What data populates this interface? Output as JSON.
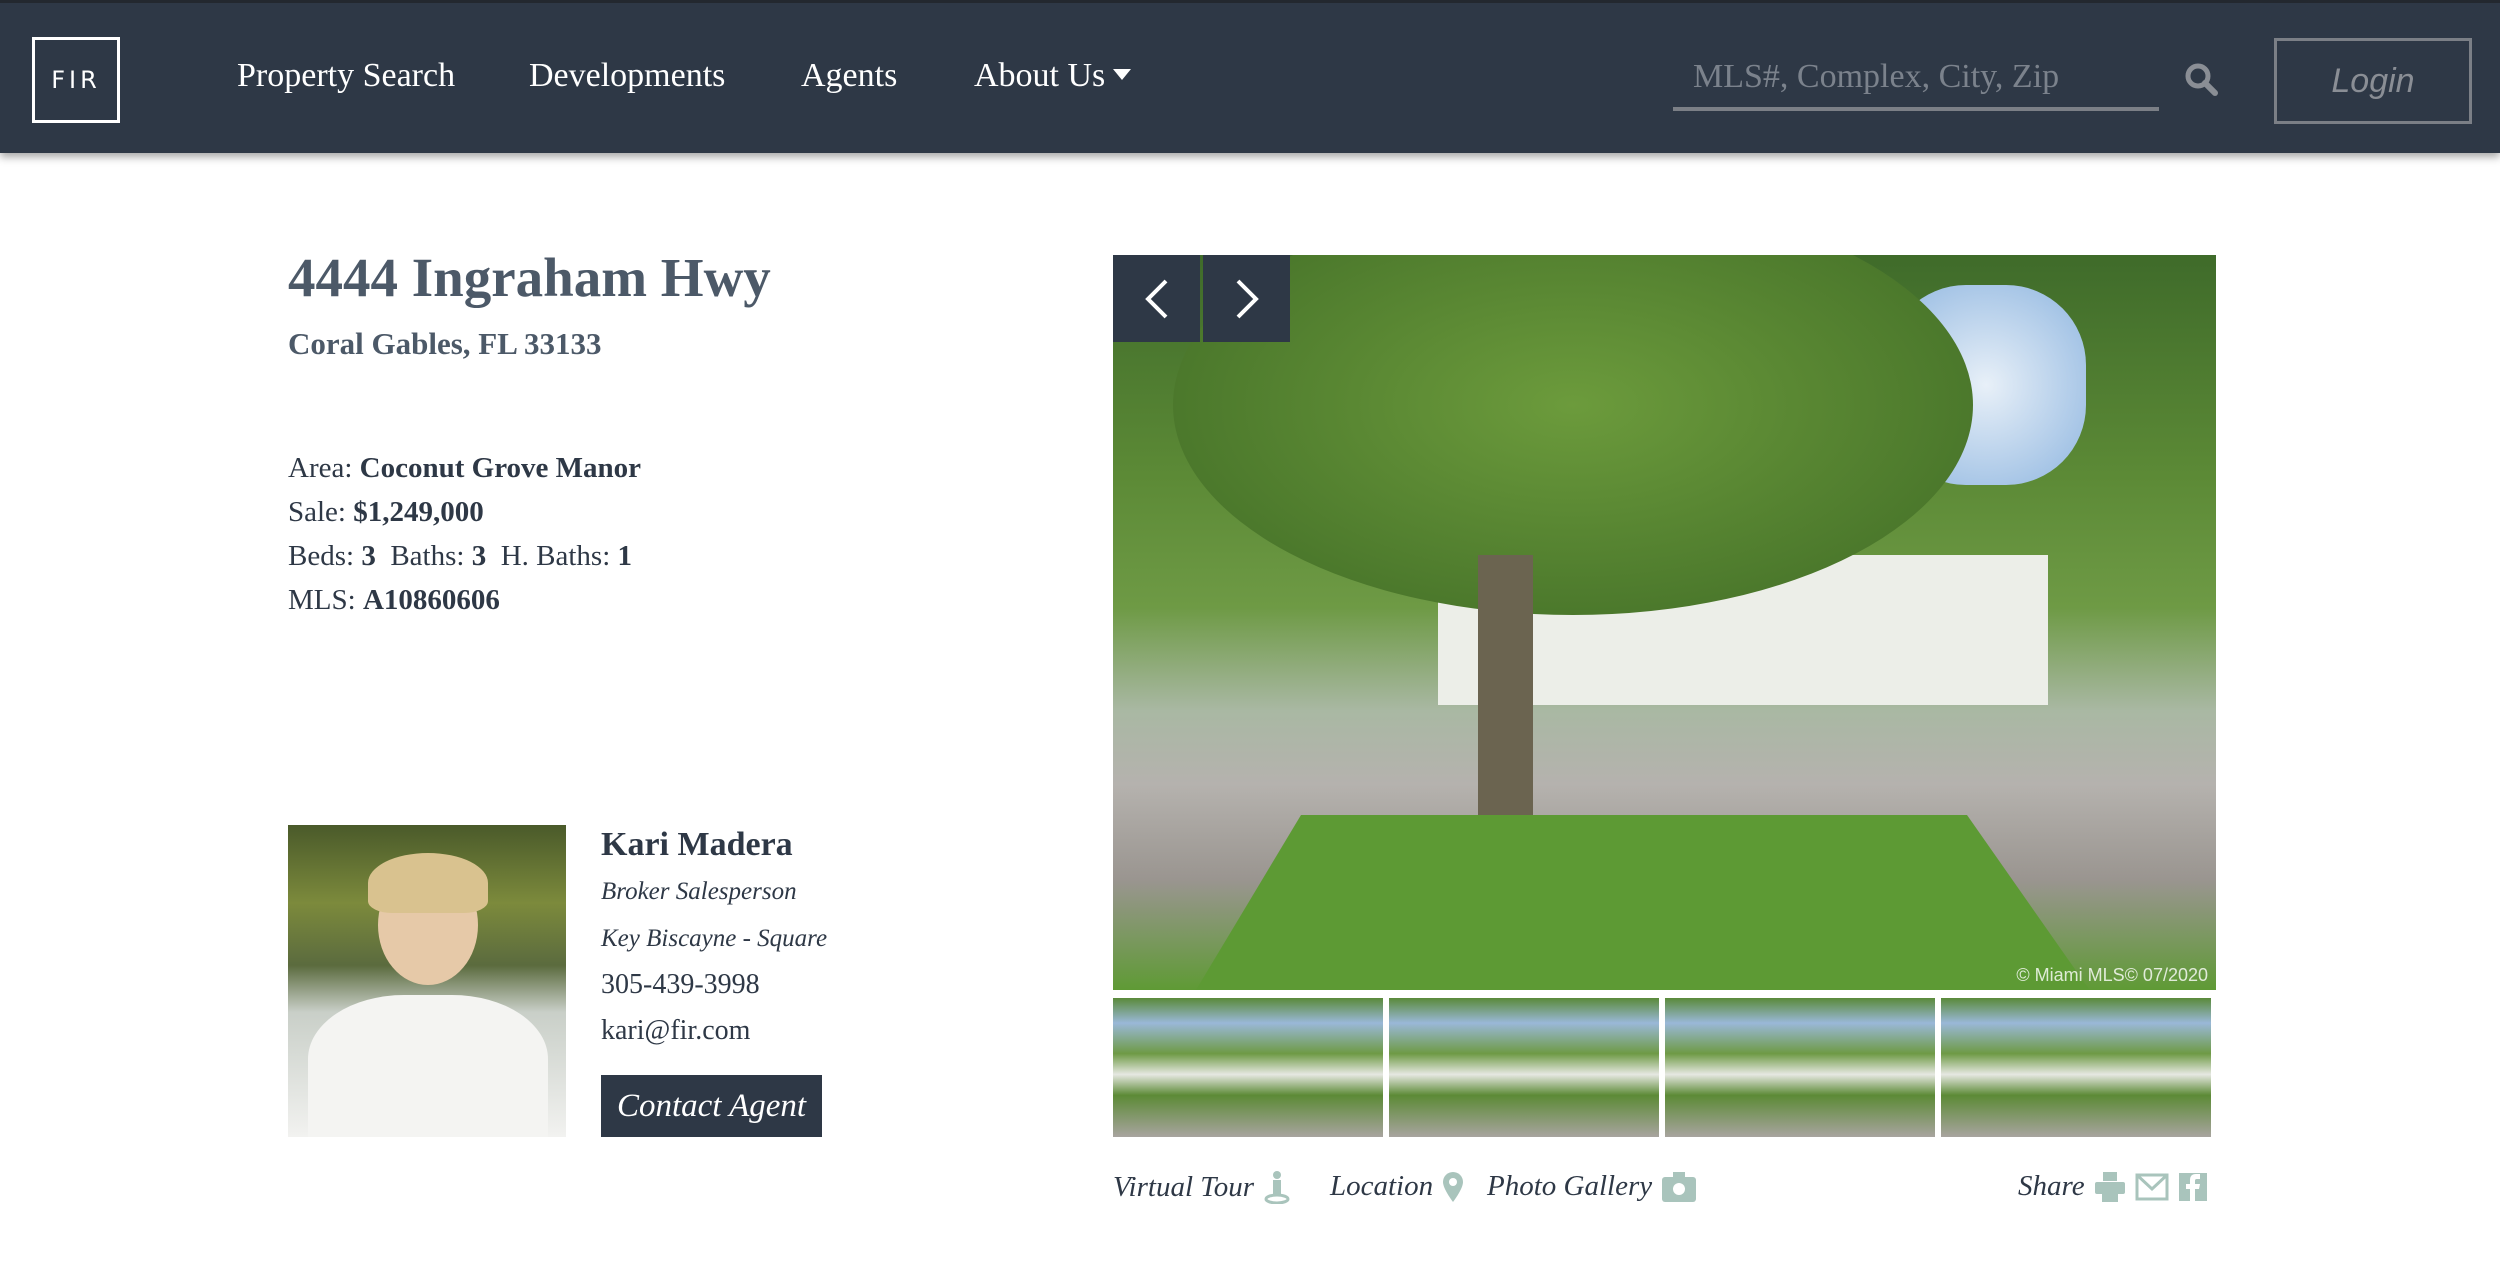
{
  "nav": {
    "logo": "FIR",
    "items": [
      {
        "label": "Property Search"
      },
      {
        "label": "Developments"
      },
      {
        "label": "Agents"
      },
      {
        "label": "About Us",
        "has_dropdown": true
      }
    ],
    "search_placeholder": "MLS#, Complex, City, Zip",
    "login": "Login"
  },
  "listing": {
    "title": "4444 Ingraham Hwy",
    "subtitle": "Coral Gables, FL 33133",
    "area_label": "Area:",
    "area": "Coconut Grove Manor",
    "sale_label": "Sale:",
    "sale": "$1,249,000",
    "beds_label": "Beds:",
    "beds": "3",
    "baths_label": "Baths:",
    "baths": "3",
    "hbaths_label": "H. Baths:",
    "hbaths": "1",
    "mls_label": "MLS:",
    "mls": "A10860606"
  },
  "agent": {
    "name": "Kari Madera",
    "role": "Broker Salesperson",
    "office": "Key Biscayne - Square",
    "phone": "305-439-3998",
    "email": "kari@fir.com",
    "contact": "Contact Agent"
  },
  "gallery": {
    "watermark": "© Miami MLS© 07/2020",
    "thumbnail_count": 4
  },
  "links": {
    "virtual_tour": "Virtual Tour",
    "location": "Location",
    "photo_gallery": "Photo Gallery",
    "share": "Share"
  },
  "colors": {
    "navy": "#2e3846",
    "heading": "#4c5968",
    "icon": "#a9c4bc"
  }
}
